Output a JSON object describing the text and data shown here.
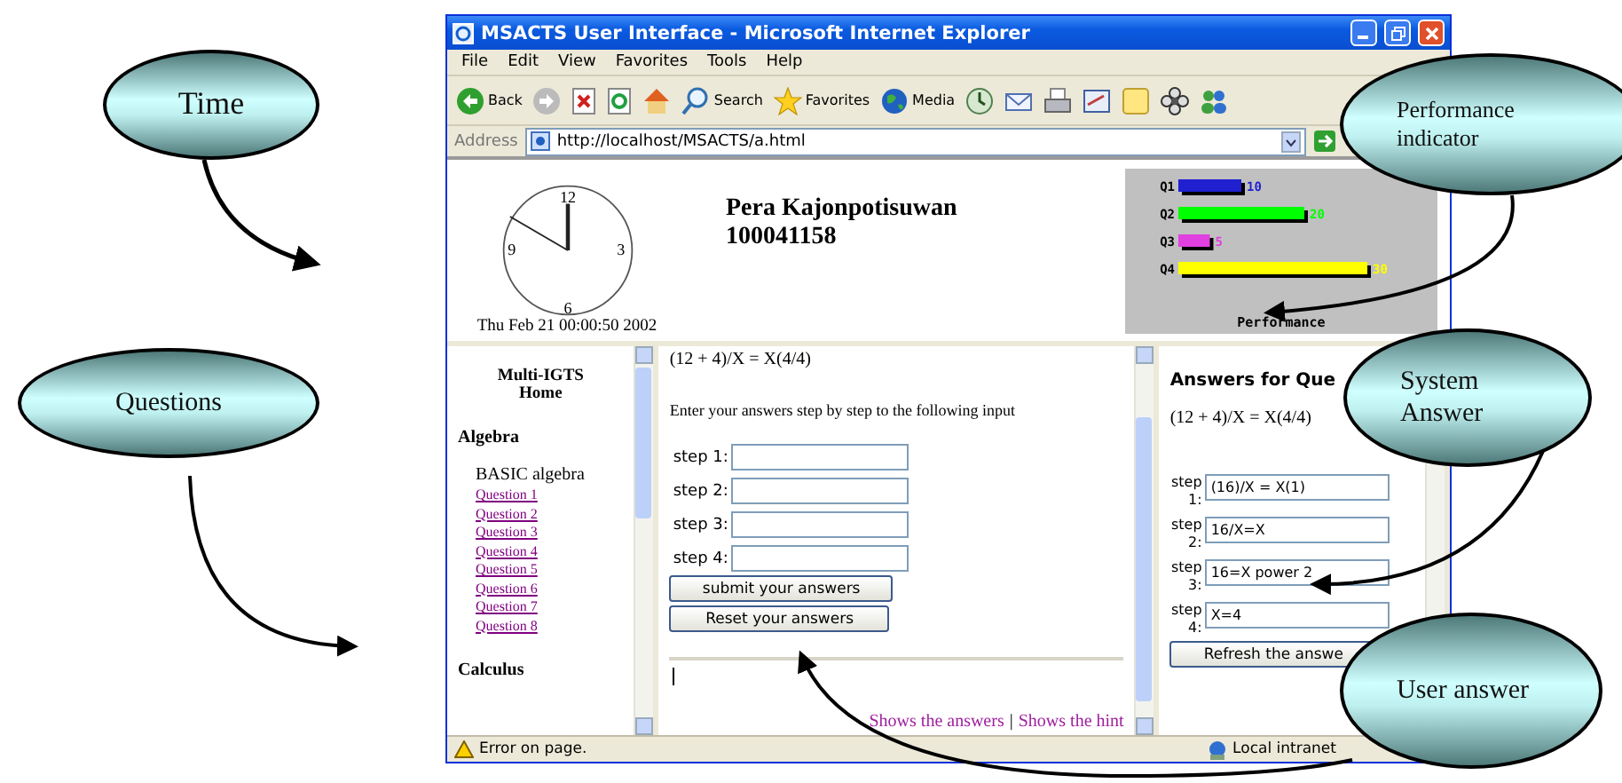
{
  "callouts": [
    {
      "kind": "time",
      "text": "Time"
    },
    {
      "kind": "questions",
      "text": "Questions"
    },
    {
      "kind": "performance",
      "text": "Performance indicator"
    },
    {
      "kind": "system",
      "text": "System Answer"
    },
    {
      "kind": "user",
      "text": "User answer"
    }
  ],
  "window": {
    "title": "MSACTS User Interface - Microsoft Internet Explorer"
  },
  "menu": [
    "File",
    "Edit",
    "View",
    "Favorites",
    "Tools",
    "Help"
  ],
  "toolbar": [
    {
      "kind": "back",
      "label": "Back"
    },
    {
      "kind": "forward"
    },
    {
      "kind": "stop"
    },
    {
      "kind": "refresh"
    },
    {
      "kind": "home"
    },
    {
      "kind": "search",
      "label": "Search"
    },
    {
      "kind": "favorites",
      "label": "Favorites"
    },
    {
      "kind": "media",
      "label": "Media"
    },
    {
      "kind": "history"
    },
    {
      "kind": "mail"
    },
    {
      "kind": "print"
    },
    {
      "kind": "edit"
    },
    {
      "kind": "note"
    },
    {
      "kind": "flower"
    },
    {
      "kind": "messenger"
    }
  ],
  "address": {
    "label": "Address",
    "url": "http://localhost/MSACTS/a.html"
  },
  "clock": {
    "numbers": [
      "12",
      "3",
      "6",
      "9"
    ],
    "date": "Thu Feb 21 00:00:50 2002"
  },
  "student": {
    "name": "Pera Kajonpotisuwan",
    "id": "100041158"
  },
  "performance": {
    "chart_data": {
      "type": "bar",
      "orientation": "horizontal",
      "title": "Performance",
      "data_labels": true,
      "categories": [
        "Q1",
        "Q2",
        "Q3",
        "Q4"
      ],
      "values": [
        10,
        20,
        5,
        30
      ],
      "colors": [
        "#2020d0",
        "#00ff00",
        "#e040e0",
        "#ffff00"
      ]
    }
  },
  "nav": {
    "title": [
      "Multi-IGTS",
      "Home"
    ],
    "sections": [
      {
        "heading": "Algebra",
        "subheading": "BASIC algebra",
        "links": [
          "Question 1",
          "Question 2",
          "Question 3",
          "Question 4",
          "Question 5",
          "Question 6",
          "Question 7",
          "Question 8"
        ]
      },
      {
        "heading": "Calculus"
      }
    ]
  },
  "question": {
    "equation": "(12 + 4)/X = X(4/4)",
    "instruction": "Enter your answers step by step to the following input",
    "steps": [
      "step 1:",
      "step 2:",
      "step 3:",
      "step 4:"
    ],
    "buttons": [
      "submit your answers",
      "Reset your answers"
    ],
    "links": [
      "Shows the answers",
      "Shows the hint"
    ],
    "separator": "|"
  },
  "answers": {
    "heading": "Answers for Que",
    "equation": "(12 + 4)/X = X(4/4)",
    "steps": [
      {
        "label": "step 1:",
        "value": "(16)/X = X(1)"
      },
      {
        "label": "step 2:",
        "value": "16/X=X"
      },
      {
        "label": "step 3:",
        "value": "16=X power 2"
      },
      {
        "label": "step 4:",
        "value": "X=4"
      }
    ],
    "button": "Refresh the answe"
  },
  "status_bar": {
    "message": "Error on page.",
    "zone": "Local intranet"
  }
}
